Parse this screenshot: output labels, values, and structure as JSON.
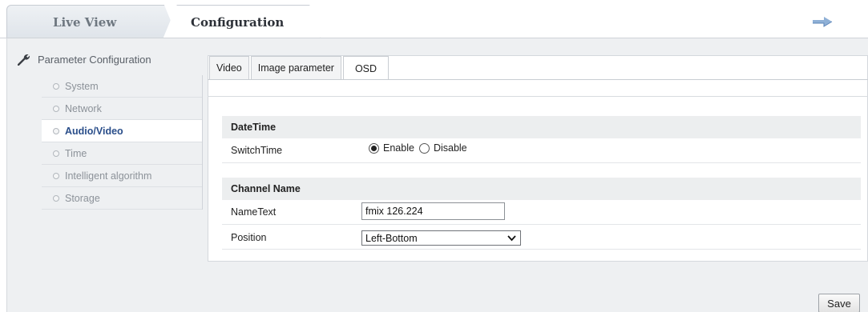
{
  "top_tabs": {
    "live_view": "Live View",
    "configuration": "Configuration"
  },
  "sidebar": {
    "header": "Parameter Configuration",
    "items": [
      {
        "label": "System"
      },
      {
        "label": "Network"
      },
      {
        "label": "Audio/Video",
        "active": true
      },
      {
        "label": "Time"
      },
      {
        "label": "Intelligent algorithm"
      },
      {
        "label": "Storage"
      }
    ]
  },
  "subtabs": [
    "Video",
    "Image parameter",
    "OSD"
  ],
  "sections": {
    "datetime": {
      "title": "DateTime",
      "switch_label": "SwitchTime",
      "enable_label": "Enable",
      "disable_label": "Disable",
      "selected": "Enable"
    },
    "channel": {
      "title": "Channel Name",
      "name_label": "NameText",
      "name_value": "fmix 126.224",
      "position_label": "Position",
      "position_value": "Left-Bottom"
    }
  },
  "save_label": "Save",
  "icons": {
    "logout": "arrow-right-icon",
    "settings": "wrench-icon"
  },
  "colors": {
    "active_link": "#2a4e8a",
    "panel_bg": "#eef0f2"
  }
}
